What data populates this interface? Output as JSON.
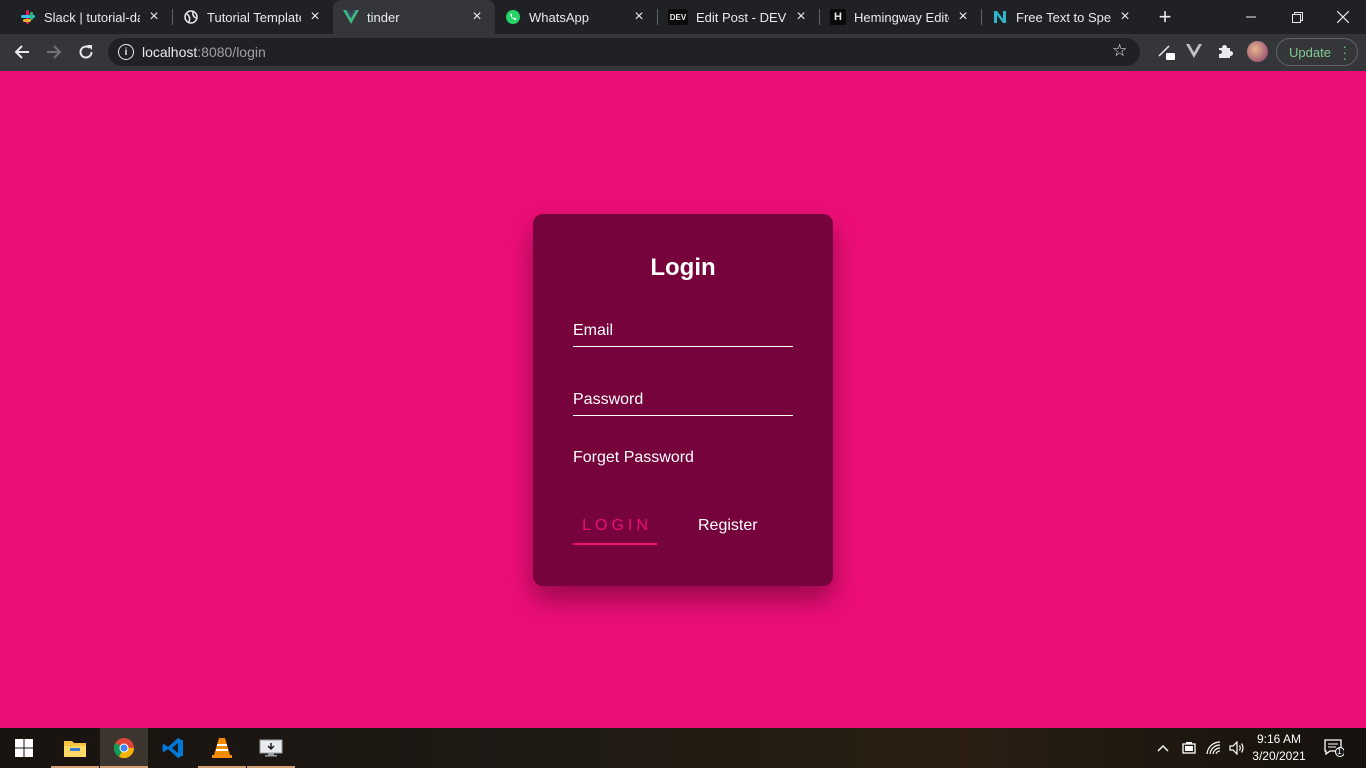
{
  "browser": {
    "tabs": [
      {
        "title": "Slack | tutorial-dal",
        "icon": "slack-icon"
      },
      {
        "title": "Tutorial Template",
        "icon": "globe-icon"
      },
      {
        "title": "tinder",
        "icon": "vue-icon",
        "active": true
      },
      {
        "title": "WhatsApp",
        "icon": "whatsapp-icon"
      },
      {
        "title": "Edit Post - DEV Co",
        "icon": "dev-icon"
      },
      {
        "title": "Hemingway Editor",
        "icon": "hemingway-icon"
      },
      {
        "title": "Free Text to Speec",
        "icon": "naturalreader-icon"
      }
    ],
    "url_host": "localhost",
    "url_path": ":8080/login",
    "update_label": "Update"
  },
  "login": {
    "title": "Login",
    "email_placeholder": "Email",
    "password_placeholder": "Password",
    "forgot_label": "Forget Password",
    "login_label": "LOGIN",
    "register_label": "Register"
  },
  "taskbar": {
    "time": "9:16 AM",
    "date": "3/20/2021",
    "notification_count": "1"
  },
  "colors": {
    "page_background": "#ec0e76",
    "card_background": "#76033c",
    "accent": "#ec0e76"
  }
}
